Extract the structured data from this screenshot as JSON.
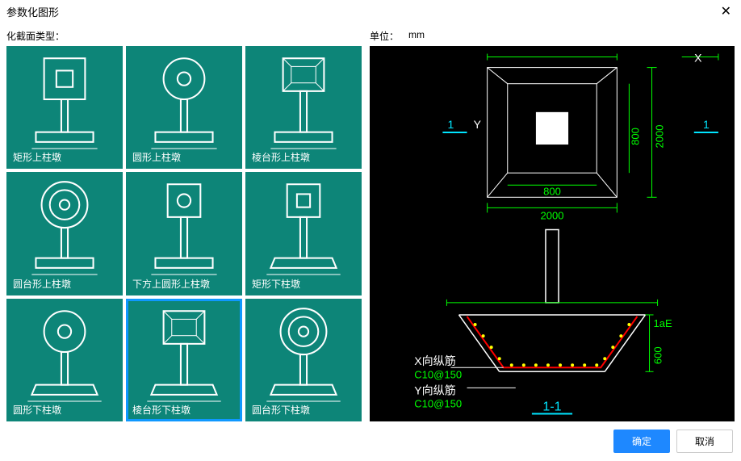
{
  "dialog": {
    "title": "参数化图形",
    "section_type_label": "化截面类型：",
    "unit_label": "单位：",
    "unit_value": "mm"
  },
  "shapes": [
    {
      "label": "矩形上柱墩"
    },
    {
      "label": "圆形上柱墩"
    },
    {
      "label": "棱台形上柱墩"
    },
    {
      "label": "圆台形上柱墩"
    },
    {
      "label": "下方上圆形上柱墩"
    },
    {
      "label": "矩形下柱墩"
    },
    {
      "label": "圆形下柱墩"
    },
    {
      "label": "棱台形下柱墩"
    },
    {
      "label": "圆台形下柱墩"
    }
  ],
  "preview": {
    "dim_x_label": "X",
    "dim_y_label": "Y",
    "dim_2000_x": "2000",
    "dim_800_x": "800",
    "dim_2000_y": "2000",
    "dim_800_y": "800",
    "section_1_left": "1",
    "section_1_right": "1",
    "section_label": "1-1",
    "rebar_x_label": "X向纵筋",
    "rebar_x_spec": "C10@150",
    "rebar_y_label": "Y向纵筋",
    "rebar_y_spec": "C10@150",
    "dim_1aE": "1aE",
    "dim_600": "600"
  },
  "buttons": {
    "ok": "确定",
    "cancel": "取消"
  }
}
